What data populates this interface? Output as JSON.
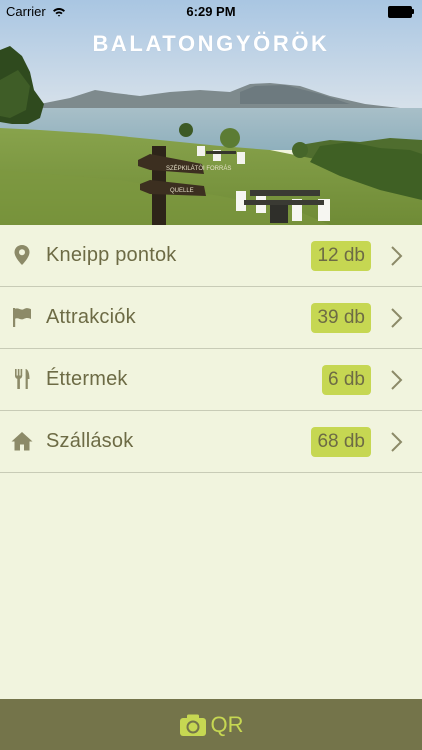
{
  "status_bar": {
    "carrier": "Carrier",
    "time": "6:29 PM"
  },
  "header": {
    "title": "BALATONGYÖRÖK",
    "sign_text_1": "SZÉPKILÁTÓI FORRÁS",
    "sign_text_2": "QUELLE"
  },
  "list": {
    "items": [
      {
        "icon": "location-pin-icon",
        "label": "Kneipp pontok",
        "badge": "12 db"
      },
      {
        "icon": "flag-icon",
        "label": "Attrakciók",
        "badge": "39 db"
      },
      {
        "icon": "fork-knife-icon",
        "label": "Éttermek",
        "badge": "6 db"
      },
      {
        "icon": "house-icon",
        "label": "Szállások",
        "badge": "68 db"
      }
    ]
  },
  "bottom_bar": {
    "label": "QR",
    "icon": "camera-icon"
  },
  "colors": {
    "background": "#f1f4de",
    "text": "#6d6b45",
    "badge": "#c6d752",
    "bottom_bar": "#74744a",
    "bottom_bar_text": "#c6d752",
    "divider": "#c8cbb6"
  }
}
